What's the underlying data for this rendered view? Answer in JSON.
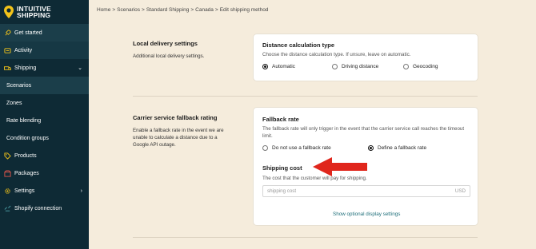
{
  "brand": {
    "line1": "INTUITIVE",
    "line2": "SHIPPING"
  },
  "sidebar": {
    "items": [
      {
        "label": "Get started",
        "icon": "rocket-icon"
      },
      {
        "label": "Activity",
        "icon": "activity-icon"
      },
      {
        "label": "Shipping",
        "icon": "truck-icon",
        "chevron": "chevron-down-icon"
      },
      {
        "label": "Scenarios"
      },
      {
        "label": "Zones"
      },
      {
        "label": "Rate blending"
      },
      {
        "label": "Condition groups"
      },
      {
        "label": "Products",
        "icon": "tag-icon"
      },
      {
        "label": "Packages",
        "icon": "box-icon"
      },
      {
        "label": "Settings",
        "icon": "gear-icon",
        "chevron": "chevron-right-icon"
      },
      {
        "label": "Shopify connection",
        "icon": "link-icon"
      }
    ]
  },
  "breadcrumb": {
    "items": [
      "Home",
      "Scenarios",
      "Standard Shipping",
      "Canada"
    ],
    "separator": ">",
    "current": "Edit shipping method"
  },
  "local_delivery": {
    "title": "Local delivery settings",
    "description": "Additional local delivery settings.",
    "card": {
      "title": "Distance calculation type",
      "description": "Choose the distance calculation type. If unsure, leave on automatic.",
      "options": [
        {
          "label": "Automatic",
          "checked": true
        },
        {
          "label": "Driving distance",
          "checked": false
        },
        {
          "label": "Geocoding",
          "checked": false
        }
      ]
    }
  },
  "fallback": {
    "title": "Carrier service fallback rating",
    "description": "Enable a fallback rate in the event we are unable to calculate a distance due to a Google API outage.",
    "card": {
      "title": "Fallback rate",
      "description": "The fallback rate will only trigger in the event that the carrier service call reaches the timeout limit.",
      "options": [
        {
          "label": "Do not use a fallback rate",
          "checked": false
        },
        {
          "label": "Define a fallback rate",
          "checked": true
        }
      ],
      "shipping_cost": {
        "title": "Shipping cost",
        "description": "The cost that the customer will pay for shipping.",
        "placeholder": "shipping cost",
        "suffix": "USD"
      },
      "link": "Show optional display settings"
    }
  },
  "colors": {
    "sidebar_bg": "#0e2a35",
    "page_bg": "#f5ecdc",
    "accent_yellow": "#f2c31a",
    "arrow_red": "#e0261c",
    "link": "#1f6f7a"
  }
}
